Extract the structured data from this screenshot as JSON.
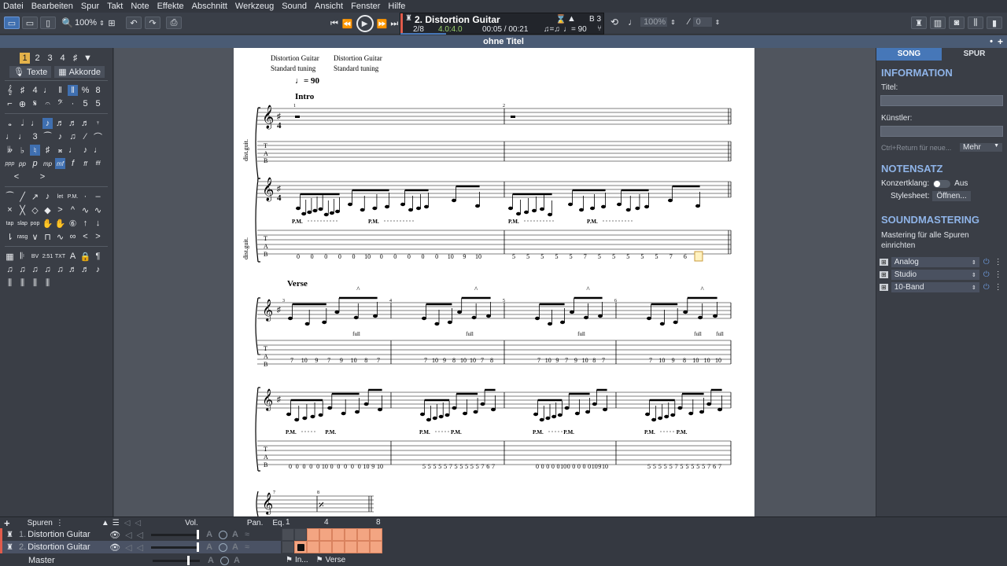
{
  "menu": [
    "Datei",
    "Bearbeiten",
    "Spur",
    "Takt",
    "Note",
    "Effekte",
    "Abschnitt",
    "Werkzeug",
    "Sound",
    "Ansicht",
    "Fenster",
    "Hilfe"
  ],
  "toolbar": {
    "zoom": "100%",
    "speed": "100%",
    "volume_value": "0"
  },
  "song": {
    "track_title": "2. Distortion Guitar",
    "bar_position": "2/8",
    "time_signature": "4.0:4.0",
    "time": "00:05 / 00:21",
    "tempo": "♩= 90",
    "key": "B 3",
    "triplet_feel": "♫=♫"
  },
  "document_title": "ohne Titel",
  "left_panel": {
    "voices": [
      "1",
      "2",
      "3",
      "4"
    ],
    "lyrics_button": "Texte",
    "chords_button": "Akkorde"
  },
  "score": {
    "tracks": [
      {
        "name": "Distortion Guitar",
        "tuning": "Standard tuning"
      },
      {
        "name": "Distortion Guitar",
        "tuning": "Standard tuning"
      }
    ],
    "tempo_mark": "= 90",
    "staff_label": "dist.guit.",
    "sections": [
      "Intro",
      "Verse"
    ],
    "palm_mute": "P.M.",
    "bend": "full",
    "intro_tab_top": [
      "0",
      "0",
      "0",
      "0",
      "0",
      "10",
      "0",
      "0",
      "0",
      "0",
      "0",
      "10",
      "9",
      "10",
      "5",
      "5",
      "5",
      "5",
      "5",
      "7",
      "5",
      "5",
      "5",
      "5",
      "5",
      "7",
      "6",
      "7"
    ],
    "verse_tab_row1": [
      "7",
      "10",
      "9",
      "7",
      "9",
      "10",
      "8",
      "7",
      "7",
      "10",
      "9",
      "8",
      "10",
      "10",
      "7",
      "8",
      "7",
      "10",
      "9",
      "7",
      "9",
      "10",
      "8",
      "7",
      "7",
      "10",
      "9",
      "8",
      "10",
      "10",
      "10"
    ],
    "verse_tab_row2": [
      "0",
      "0",
      "0",
      "0",
      "0",
      "10",
      "0",
      "0",
      "0",
      "0",
      "0",
      "10",
      "9",
      "10",
      "5",
      "5",
      "5",
      "5",
      "5",
      "7",
      "5",
      "5",
      "5",
      "5",
      "5",
      "7",
      "6",
      "7",
      "0",
      "0",
      "0",
      "0",
      "0",
      "10",
      "0",
      "0",
      "0",
      "0",
      "0",
      "10",
      "9",
      "10",
      "5",
      "5",
      "5",
      "5",
      "5",
      "7",
      "5",
      "5",
      "5",
      "5",
      "5",
      "7",
      "6",
      "7"
    ],
    "bar_numbers": [
      "1",
      "2",
      "3",
      "4",
      "5",
      "6",
      "7",
      "8"
    ]
  },
  "right_panel": {
    "tabs": [
      "SONG",
      "SPUR"
    ],
    "information_heading": "INFORMATION",
    "title_label": "Titel:",
    "artist_label": "Künstler:",
    "new_hint": "Ctrl+Return für neue...",
    "more_button": "Mehr",
    "notation_heading": "NOTENSATZ",
    "concert_pitch_label": "Konzertklang:",
    "concert_pitch_value": "Aus",
    "stylesheet_label": "Stylesheet:",
    "stylesheet_button": "Öffnen...",
    "mastering_heading": "SOUNDMASTERING",
    "mastering_desc": "Mastering für alle Spuren einrichten",
    "mastering_presets": [
      "Analog",
      "Studio",
      "10-Band"
    ]
  },
  "bottom": {
    "tracks_label": "Spuren",
    "vol_label": "Vol.",
    "pan_label": "Pan.",
    "eq_label": "Eq.",
    "ruler": [
      "1",
      "4",
      "8"
    ],
    "tracks": [
      {
        "num": "1.",
        "name": "Distortion Guitar"
      },
      {
        "num": "2.",
        "name": "Distortion Guitar"
      }
    ],
    "master_label": "Master",
    "markers": [
      "In...",
      "Verse"
    ]
  },
  "colors": {
    "accent": "#4677b8",
    "grid_fill": "#f3a582",
    "heading": "#8fb4e8"
  }
}
